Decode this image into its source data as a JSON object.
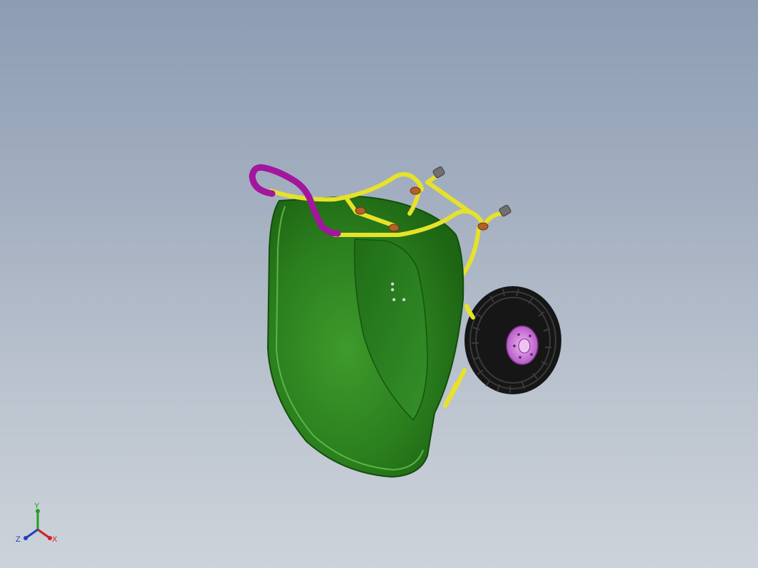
{
  "viewport": {
    "background_top": "#8d9cb3",
    "background_bottom": "#cdd3da"
  },
  "model": {
    "parts": {
      "tray": {
        "color": "#2f8a22"
      },
      "frame": {
        "color": "#e6e22a"
      },
      "handle_grips": {
        "color": "#a3169e"
      },
      "wheel_tire": {
        "color": "#161616"
      },
      "wheel_hub": {
        "color": "#d77ce6"
      },
      "clamps": {
        "color": "#b2612a"
      },
      "feet_caps": {
        "color": "#707070"
      }
    }
  },
  "triad": {
    "x_label": "X",
    "y_label": "Y",
    "z_label": "Z",
    "x_color": "#d02020",
    "y_color": "#20a020",
    "z_color": "#2040c0"
  }
}
